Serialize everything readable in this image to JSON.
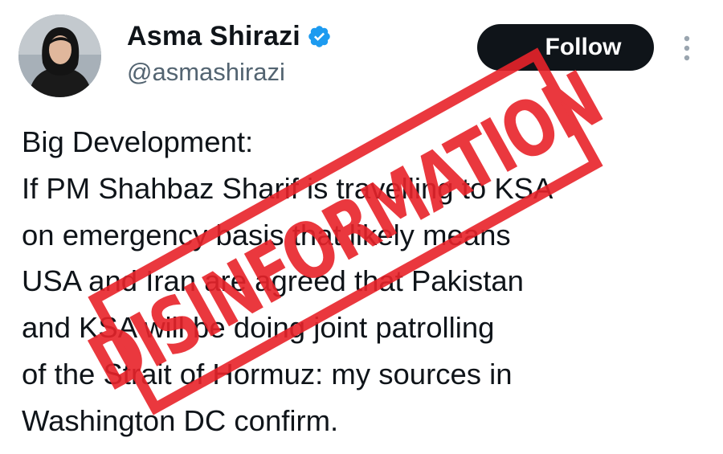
{
  "author": {
    "display_name": "Asma Shirazi",
    "handle": "@asmashirazi",
    "verified": true,
    "avatar_icon": "profile-photo"
  },
  "actions": {
    "follow_label": "Follow",
    "more_icon": "more-vertical-icon"
  },
  "tweet": {
    "text": "Big Development:\nIf PM Shahbaz Sharif is travelling to KSA\non emergency basis that likely means\nUSA and Iran are agreed that Pakistan\nand KSA will be doing joint patrolling\nof the Strait of Hormuz: my sources in\nWashington DC confirm."
  },
  "overlay": {
    "stamp_text": "DISINFORMATION",
    "stamp_color": "#e8232a"
  },
  "colors": {
    "verified_blue": "#1d9bf0",
    "button_dark": "#0f1419",
    "secondary_text": "#536471"
  }
}
